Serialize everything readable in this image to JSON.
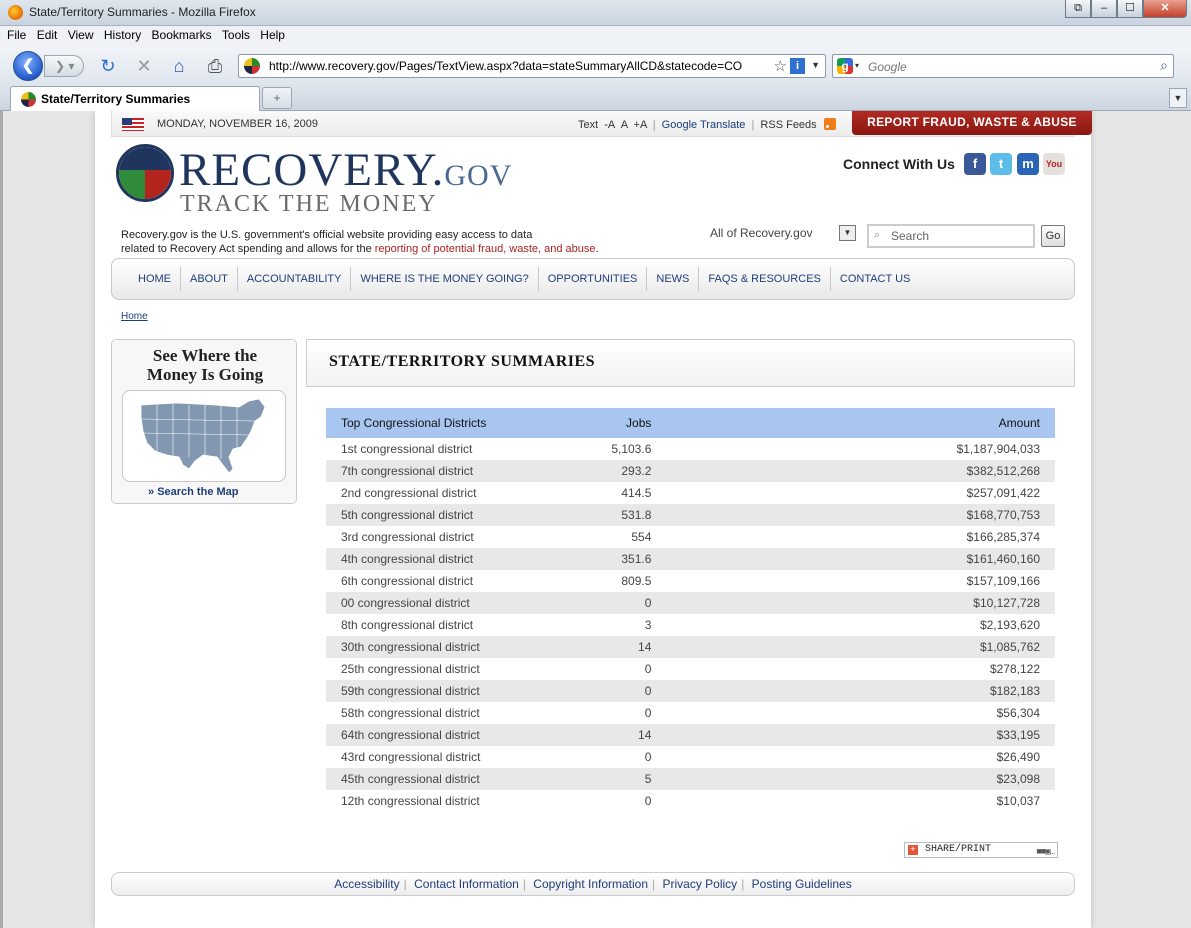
{
  "browser": {
    "window_title": "State/Territory Summaries - Mozilla Firefox",
    "menu": [
      "File",
      "Edit",
      "View",
      "History",
      "Bookmarks",
      "Tools",
      "Help"
    ],
    "url": "http://www.recovery.gov/Pages/TextView.aspx?data=stateSummaryAllCD&statecode=CO",
    "search_placeholder": "Google",
    "tab_title": "State/Territory Summaries"
  },
  "topbar": {
    "date": "MONDAY, NOVEMBER 16, 2009",
    "text_label": "Text",
    "text_smaller": "-A",
    "text_normal": "A",
    "text_larger": "+A",
    "google_translate": "Google Translate",
    "rss_feeds": "RSS Feeds",
    "report_fraud": "REPORT FRAUD, WASTE & ABUSE"
  },
  "header": {
    "logo_main": "RECOVERY.",
    "logo_gov": "GOV",
    "logo_sub": "TRACK THE MONEY",
    "connect": "Connect With Us",
    "desc_line1": "Recovery.gov is the U.S. government's official website providing easy access to data",
    "desc_line2_prefix": "related to Recovery Act spending and allows for the ",
    "desc_line2_link": "reporting of potential fraud, waste, and abuse",
    "desc_line2_suffix": ".",
    "search_scope": "All of Recovery.gov",
    "search_placeholder": "Search",
    "go": "Go"
  },
  "nav": [
    "HOME",
    "ABOUT",
    "ACCOUNTABILITY",
    "WHERE IS THE MONEY GOING?",
    "OPPORTUNITIES",
    "NEWS",
    "FAQS & RESOURCES",
    "CONTACT US"
  ],
  "breadcrumb": "Home",
  "sidebar": {
    "heading_line1": "See Where the",
    "heading_line2": "Money Is Going",
    "search_map": "Search the Map"
  },
  "content": {
    "title": "STATE/TERRITORY SUMMARIES",
    "columns": [
      "Top Congressional Districts",
      "Jobs",
      "Amount"
    ],
    "rows": [
      {
        "district": "1st congressional district",
        "jobs": "5,103.6",
        "amount": "$1,187,904,033"
      },
      {
        "district": "7th congressional district",
        "jobs": "293.2",
        "amount": "$382,512,268"
      },
      {
        "district": "2nd congressional district",
        "jobs": "414.5",
        "amount": "$257,091,422"
      },
      {
        "district": "5th congressional district",
        "jobs": "531.8",
        "amount": "$168,770,753"
      },
      {
        "district": "3rd congressional district",
        "jobs": "554",
        "amount": "$166,285,374"
      },
      {
        "district": "4th congressional district",
        "jobs": "351.6",
        "amount": "$161,460,160"
      },
      {
        "district": "6th congressional district",
        "jobs": "809.5",
        "amount": "$157,109,166"
      },
      {
        "district": "00 congressional district",
        "jobs": "0",
        "amount": "$10,127,728"
      },
      {
        "district": "8th congressional district",
        "jobs": "3",
        "amount": "$2,193,620"
      },
      {
        "district": "30th congressional district",
        "jobs": "14",
        "amount": "$1,085,762"
      },
      {
        "district": "25th congressional district",
        "jobs": "0",
        "amount": "$278,122"
      },
      {
        "district": "59th congressional district",
        "jobs": "0",
        "amount": "$182,183"
      },
      {
        "district": "58th congressional district",
        "jobs": "0",
        "amount": "$56,304"
      },
      {
        "district": "64th congressional district",
        "jobs": "14",
        "amount": "$33,195"
      },
      {
        "district": "43rd congressional district",
        "jobs": "0",
        "amount": "$26,490"
      },
      {
        "district": "45th congressional district",
        "jobs": "5",
        "amount": "$23,098"
      },
      {
        "district": "12th congressional district",
        "jobs": "0",
        "amount": "$10,037"
      }
    ]
  },
  "share": "SHARE/PRINT",
  "footer": [
    "Accessibility",
    "Contact Information",
    "Copyright Information",
    "Privacy Policy",
    "Posting Guidelines"
  ],
  "colors": {
    "brand_navy": "#1f355e",
    "fraud_red": "#a3221b",
    "table_header": "#a9c6f0",
    "row_alt": "#e8e8e8",
    "link_blue": "#1f3d7a"
  }
}
